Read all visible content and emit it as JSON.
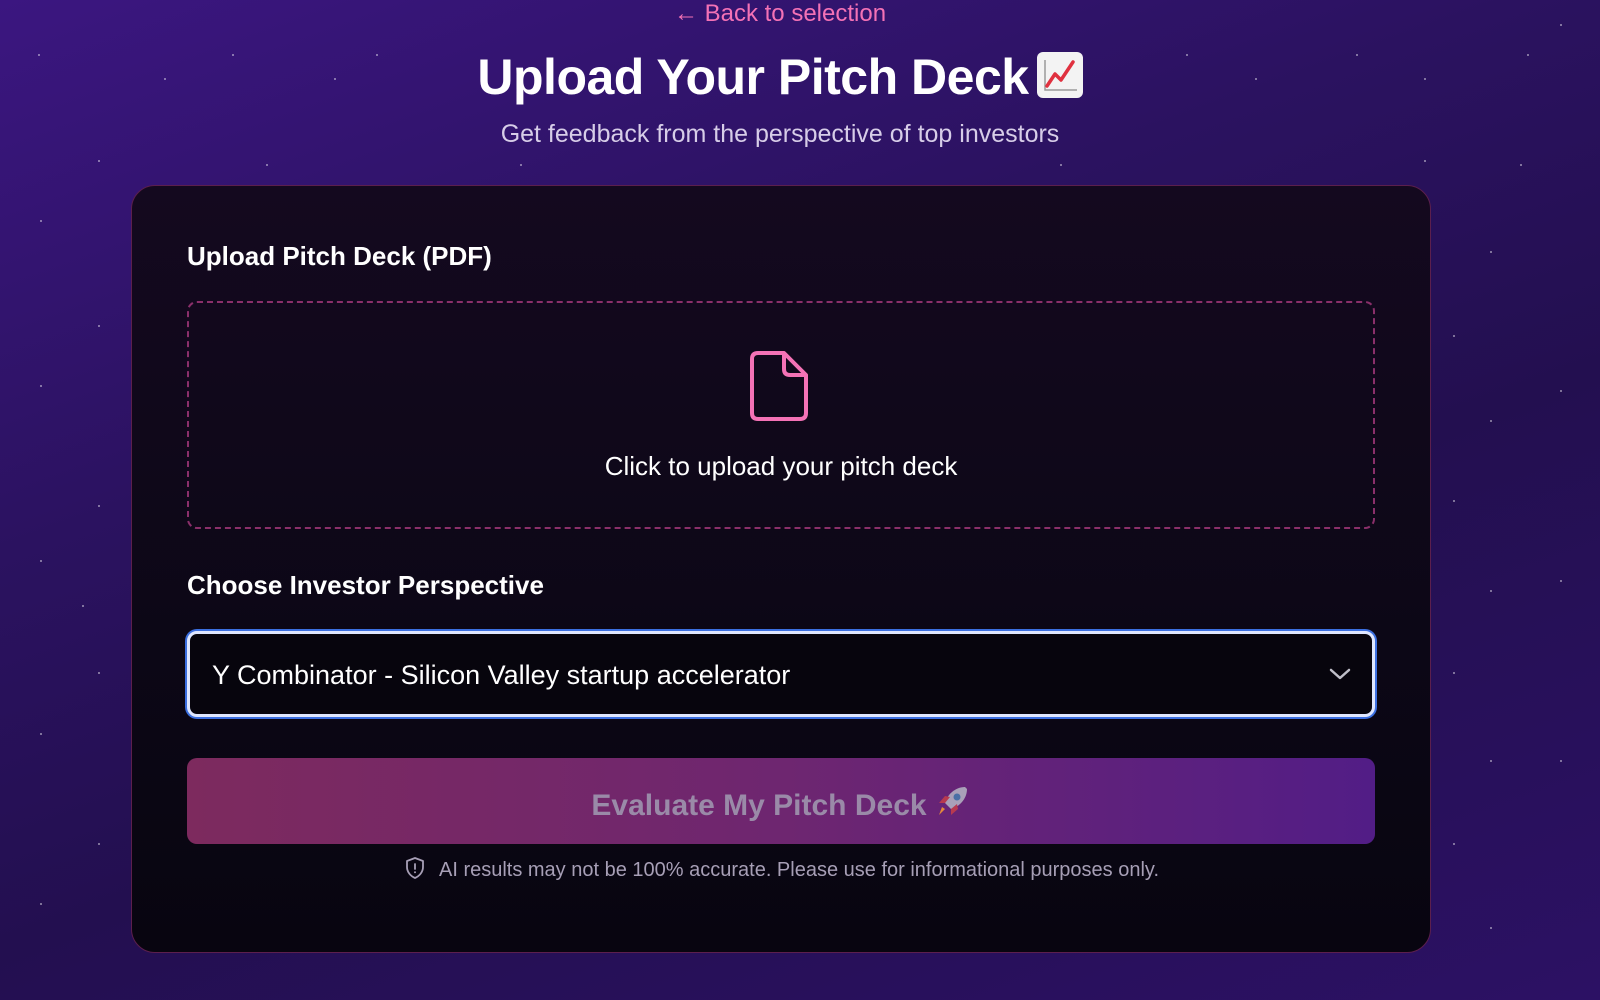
{
  "header": {
    "back_link": "← Back to selection",
    "title": "Upload Your Pitch Deck",
    "title_emoji": "chart-increasing-icon",
    "subtitle": "Get feedback from the perspective of top investors"
  },
  "upload": {
    "label": "Upload Pitch Deck (PDF)",
    "prompt": "Click to upload your pitch deck",
    "icon": "file-icon"
  },
  "investor": {
    "label": "Choose Investor Perspective",
    "selected": "Y Combinator - Silicon Valley startup accelerator"
  },
  "evaluate": {
    "label": "Evaluate My Pitch Deck",
    "icon": "rocket-icon",
    "state": "disabled"
  },
  "disclaimer": {
    "text": "AI results may not be 100% accurate. Please use for informational purposes only.",
    "icon": "shield-icon"
  },
  "colors": {
    "accent_pink": "#f472b6",
    "focus_ring": "#3b6fe0",
    "button_gradient_start": "#7d2a5e",
    "button_gradient_end": "#521d86"
  }
}
